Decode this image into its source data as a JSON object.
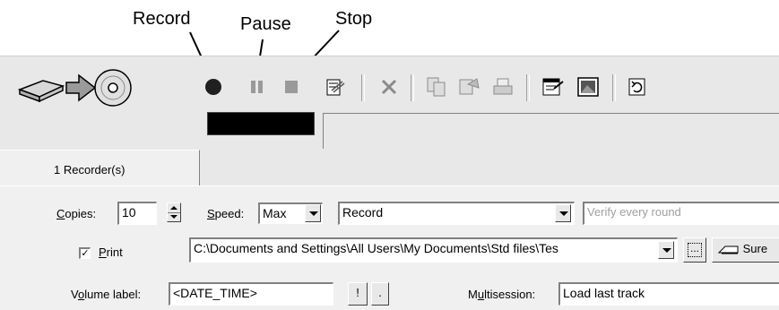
{
  "callouts": {
    "record": "Record",
    "pause": "Pause",
    "stop": "Stop"
  },
  "toolbar": {
    "icons": [
      "drive-to-disc-icon",
      "record-icon",
      "pause-icon",
      "stop-icon",
      "erase-icon",
      "delete-icon",
      "copy-icon",
      "duplicate-icon",
      "print-icon",
      "properties-icon",
      "monitor-icon",
      "refresh-icon"
    ]
  },
  "tabs": [
    {
      "label": "1 Recorder(s)"
    }
  ],
  "form": {
    "copies_label_u": "C",
    "copies_label_rest": "opies:",
    "copies_value": "10",
    "speed_label_u": "S",
    "speed_label_rest": "peed:",
    "speed_value": "Max",
    "mode_value": "Record",
    "verify_placeholder": "Verify every round",
    "print_checked_glyph": "✓",
    "print_label_u": "P",
    "print_label_rest": "rint",
    "print_path": "C:\\Documents and Settings\\All Users\\My Documents\\Std files\\Tes",
    "browse_label": "...",
    "sure_label": "Sure",
    "volume_label_pre": "V",
    "volume_label_u": "o",
    "volume_label_rest": "lume label:",
    "volume_value": "<DATE_TIME>",
    "excl_label": "!",
    "dot_label": ".",
    "multisession_pre": "M",
    "multisession_u": "u",
    "multisession_rest": "ltisession:",
    "multisession_value": "Load last track"
  },
  "colors": {
    "toolbar_bg": "#e8e8e8",
    "panel_bg": "#f0f0f0",
    "status_black": "#000000"
  }
}
